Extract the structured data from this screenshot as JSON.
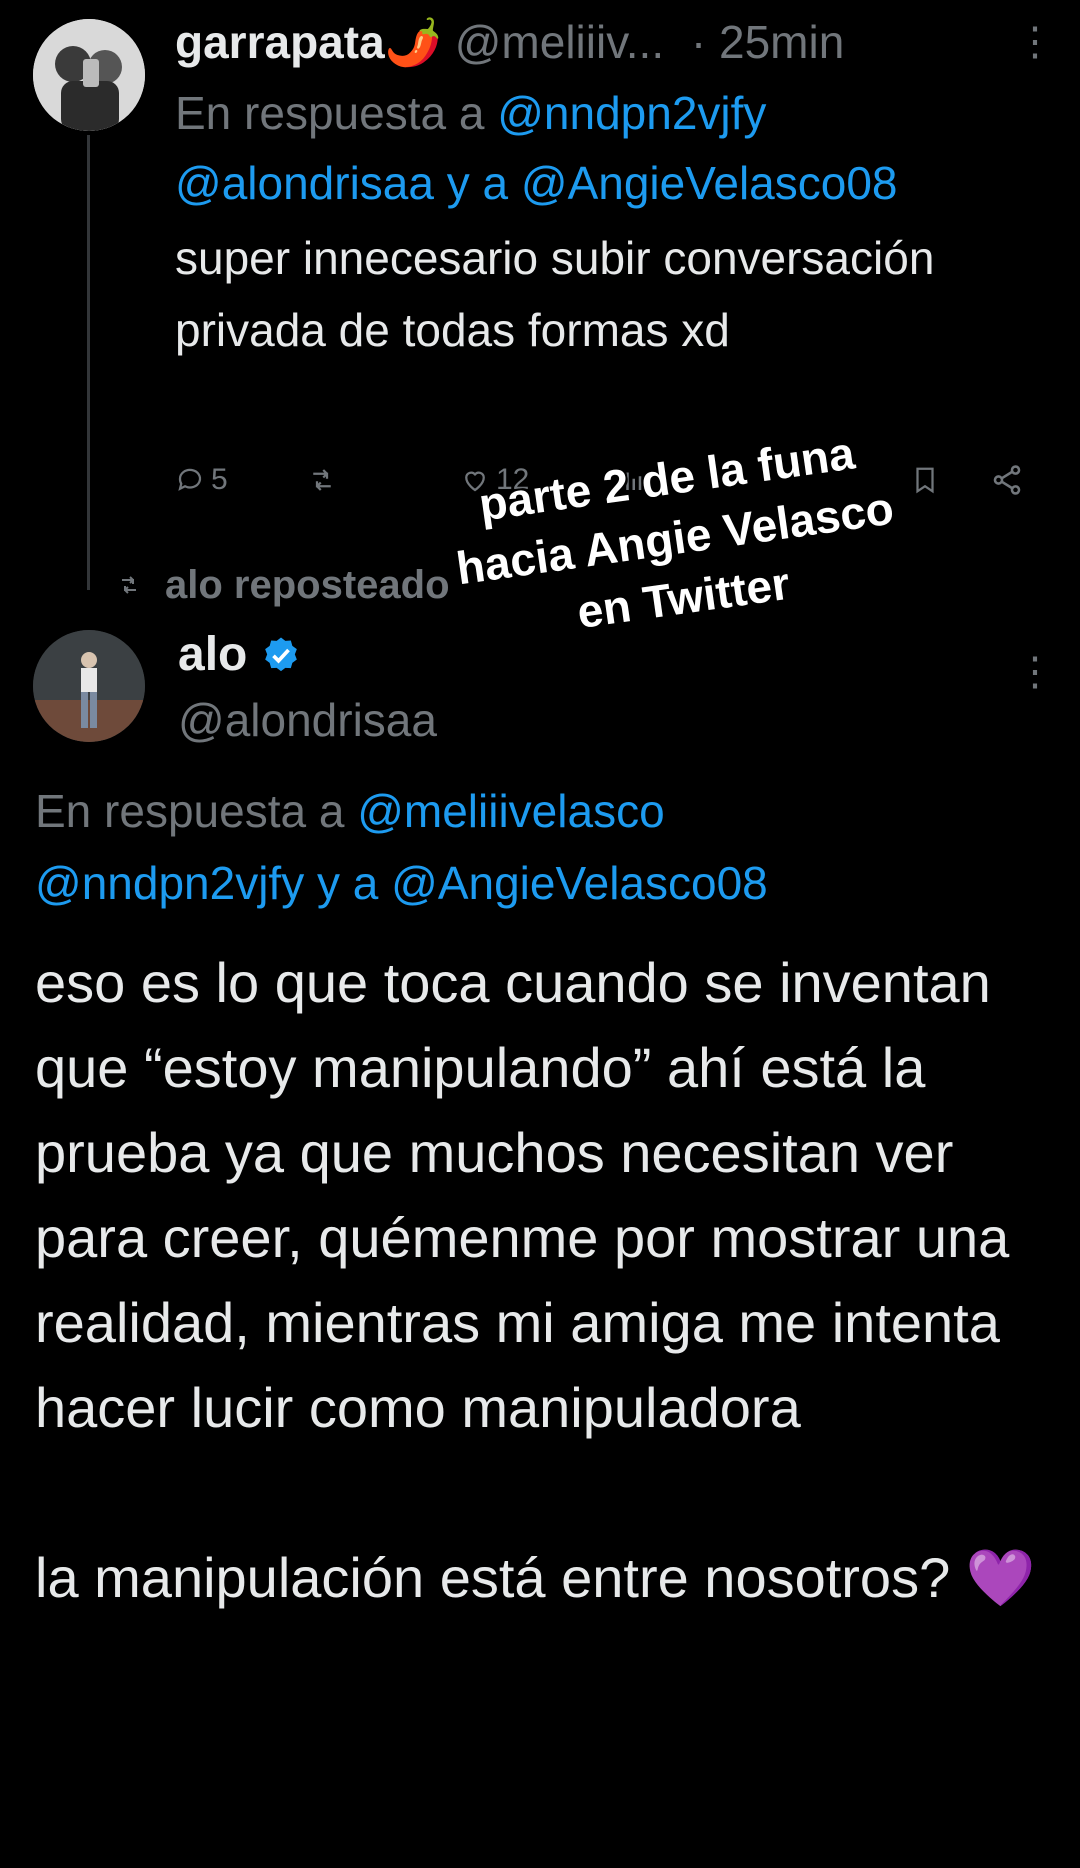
{
  "tweet1": {
    "display_name": "garrapata",
    "name_emoji": "🌶️",
    "handle": "@meliiiv...",
    "time": "· 25min",
    "reply_prefix": "En respuesta a",
    "reply_handle1": "@nndpn2vjfy",
    "reply_handles2": "@alondrisaa y a @AngieVelasco08",
    "text": "super innecesario subir conversación privada de todas formas xd",
    "replies": "5",
    "likes": "12"
  },
  "repost_label": "alo reposteado",
  "overlay_lines": [
    "parte 2 de la funa",
    "hacia Angie Velasco",
    "en Twitter"
  ],
  "tweet2": {
    "display_name": "alo",
    "handle": "@alondrisaa",
    "reply_prefix": "En respuesta a",
    "reply_handle1": "@meliiivelasco",
    "reply_handles2": "@nndpn2vjfy y a @AngieVelasco08",
    "text_part1": "eso es lo que toca cuando se inventan que “estoy manipulando” ahí está la prueba ya que muchos necesitan ver para creer, quémenme por mostrar una realidad, mientras mi amiga me intenta hacer lucir como manipuladora",
    "text_part2": "la manipulación está entre nosotros?",
    "text_emoji": "💜"
  },
  "colors": {
    "background": "#000000",
    "text": "#e7e9ea",
    "muted": "#71767b",
    "link": "#1d9bf0",
    "verified": "#1d9bf0"
  },
  "icons": [
    "reply-icon",
    "repost-icon",
    "like-icon",
    "views-icon",
    "bookmark-icon",
    "share-icon",
    "more-icon",
    "verified-badge-icon"
  ]
}
